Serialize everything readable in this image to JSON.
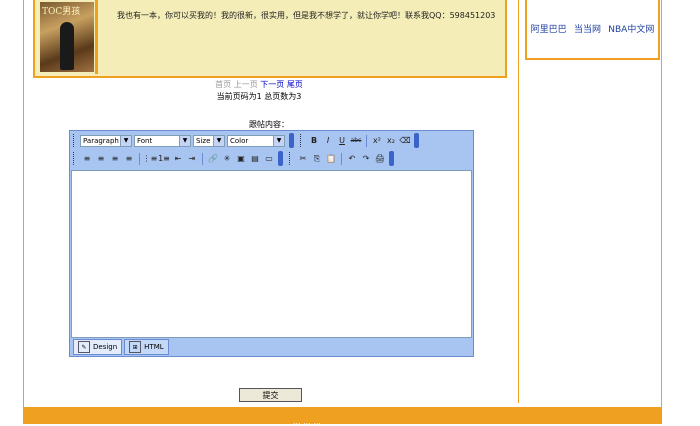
{
  "sidebar": {
    "links": [
      "阿里巴巴",
      "当当网",
      "NBA中文网"
    ]
  },
  "reply": {
    "avatar_title": "TOC男孩",
    "text": "我也有一本，你可以买我的！我的很新，很实用，但是我不想学了，就让你学吧！联系我QQ：598451203"
  },
  "pager": {
    "first": "首页",
    "prev": "上一页",
    "next": "下一页",
    "last": "尾页",
    "info": "当前页码为1 总页数为3"
  },
  "form": {
    "content_label": "跟帖内容：",
    "submit_label": "提交"
  },
  "editor": {
    "selects": [
      "Paragraph",
      "Font",
      "Size",
      "Color"
    ],
    "format_buttons": [
      "B",
      "I",
      "U",
      "abc",
      "x²",
      "x₂",
      "⌫"
    ],
    "row2_buttons": [
      "≡",
      "≡",
      "≡",
      "≡",
      "⋮≡",
      "1≡",
      "⇤",
      "⇥",
      "🔗",
      "✳",
      "▣",
      "▤",
      "▭",
      "✂",
      "⎘",
      "📋",
      "↶",
      "↷",
      "🖨"
    ],
    "tabs": [
      {
        "label": "Design",
        "icon": "✎"
      },
      {
        "label": "HTML",
        "icon": "⊞"
      }
    ]
  },
  "footer": {
    "text": "... ... ..."
  },
  "colors": {
    "accent": "#f0a020",
    "reply_bg": "#f5edb8",
    "editor_bg": "#a8c4f0"
  }
}
